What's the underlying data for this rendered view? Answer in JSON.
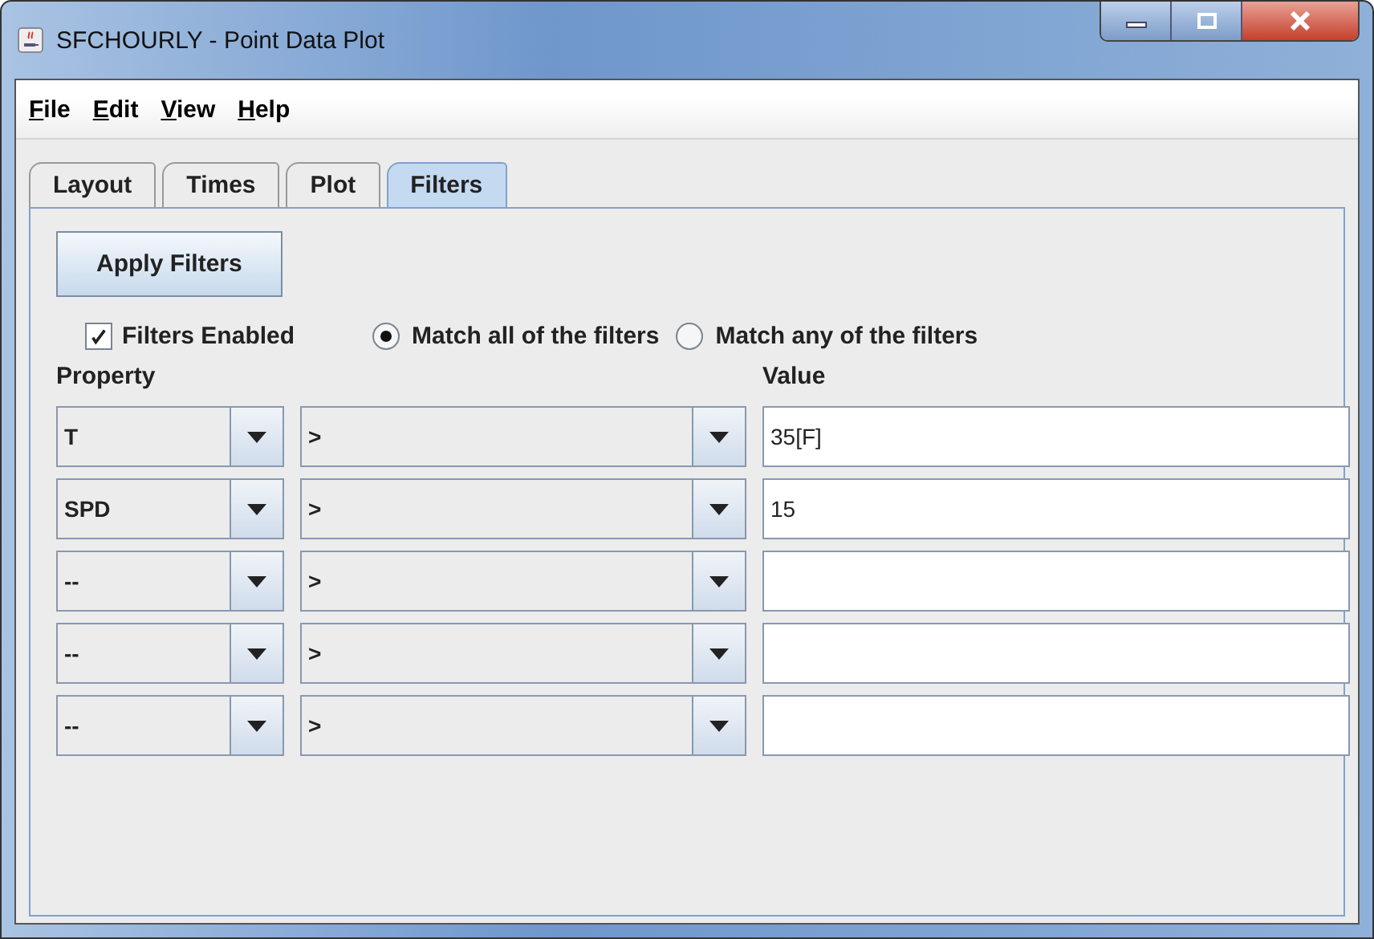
{
  "window": {
    "title": "SFCHOURLY - Point Data Plot"
  },
  "menu": [
    "File",
    "Edit",
    "View",
    "Help"
  ],
  "tabs": [
    {
      "label": "Layout",
      "selected": false
    },
    {
      "label": "Times",
      "selected": false
    },
    {
      "label": "Plot",
      "selected": false
    },
    {
      "label": "Filters",
      "selected": true
    }
  ],
  "apply_button": "Apply Filters",
  "filters_enabled": {
    "label": "Filters Enabled",
    "checked": true
  },
  "match": [
    {
      "label": "Match all of the filters",
      "selected": true
    },
    {
      "label": "Match any of the filters",
      "selected": false
    }
  ],
  "columns": {
    "property": "Property",
    "value": "Value"
  },
  "rows": [
    {
      "property": "T",
      "operator": ">",
      "value": "35[F]"
    },
    {
      "property": "SPD",
      "operator": ">",
      "value": "15"
    },
    {
      "property": "--",
      "operator": ">"
    },
    {
      "property": "--",
      "operator": ">"
    },
    {
      "property": "--",
      "operator": ">"
    }
  ]
}
